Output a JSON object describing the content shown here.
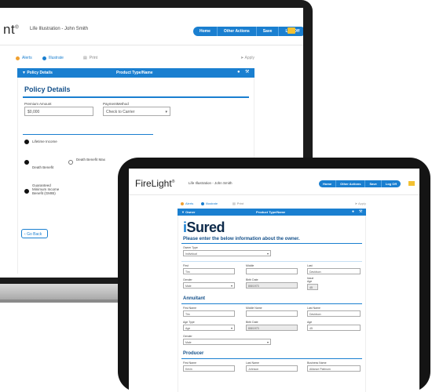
{
  "laptop": {
    "logo_text": "nt",
    "logo_mark": "®",
    "illustration_title": "Life Illustration - John Smith",
    "nav_buttons": [
      "Home",
      "Other Actions",
      "Save",
      "Log Off"
    ],
    "tabs": {
      "alerts": "Alerts",
      "illustrate": "Illustrate",
      "print": "Print",
      "apply": "Apply"
    },
    "bar_left": "Policy Details",
    "bar_center": "Product Type/Name",
    "heading": "Policy Details",
    "premium_label": "Premium Amount",
    "premium_value": "$0,000",
    "payment_label": "PaymentMethod",
    "payment_value": "Check to Carrier",
    "option_lifetime": "Lifetime Income",
    "option_death": "Death Benefit",
    "option_death_max": "Death Benefit Max",
    "option_gmib": "Guaranteed Minimum Income Benefit (GMIB)",
    "back_label": "Go Back"
  },
  "tablet": {
    "logo_text": "FireLight",
    "logo_mark": "®",
    "illustration_title": "Life Illustration - John Smith",
    "nav_buttons": [
      "Home",
      "Other Actions",
      "Save",
      "Log Off"
    ],
    "tabs": {
      "alerts": "Alerts",
      "illustrate": "Illustrate",
      "print": "Print",
      "apply": "Apply"
    },
    "bar_left": "Owner",
    "bar_center": "Product Type/Name",
    "brand": {
      "i": "i",
      "rest": "Sured"
    },
    "subheading": "Please enter the below information about the owner.",
    "owner": {
      "type_label": "Owner Type",
      "type_value": "Individual",
      "first_label": "First",
      "first_value": "Tim",
      "middle_label": "Middle",
      "middle_value": "",
      "last_label": "Last",
      "last_value": "Davidson",
      "gender_label": "Gender",
      "gender_value": "Male",
      "dob_label": "Birth Date",
      "dob_value": "8/8/1973",
      "issue_age_label": "Issue Age",
      "issue_age_value": "45"
    },
    "annuitant_heading": "Annuitant",
    "annuitant": {
      "first_label": "First Name",
      "first_value": "Tim",
      "middle_label": "Middle Name",
      "middle_value": "",
      "last_label": "Last Name",
      "last_value": "Davidson",
      "agetype_label": "Age Type",
      "agetype_value": "Age",
      "dob_label": "Birth Date",
      "dob_value": "8/8/1973",
      "age_label": "Age",
      "age_value": "45",
      "gender_label": "Gender",
      "gender_value": "Male"
    },
    "producer_heading": "Producer",
    "producer": {
      "first_label": "First Name",
      "first_value": "Kevin",
      "last_label": "Last Name",
      "last_value": "Johnson",
      "business_label": "Business Name",
      "business_value": "Alliance Platinum"
    }
  }
}
